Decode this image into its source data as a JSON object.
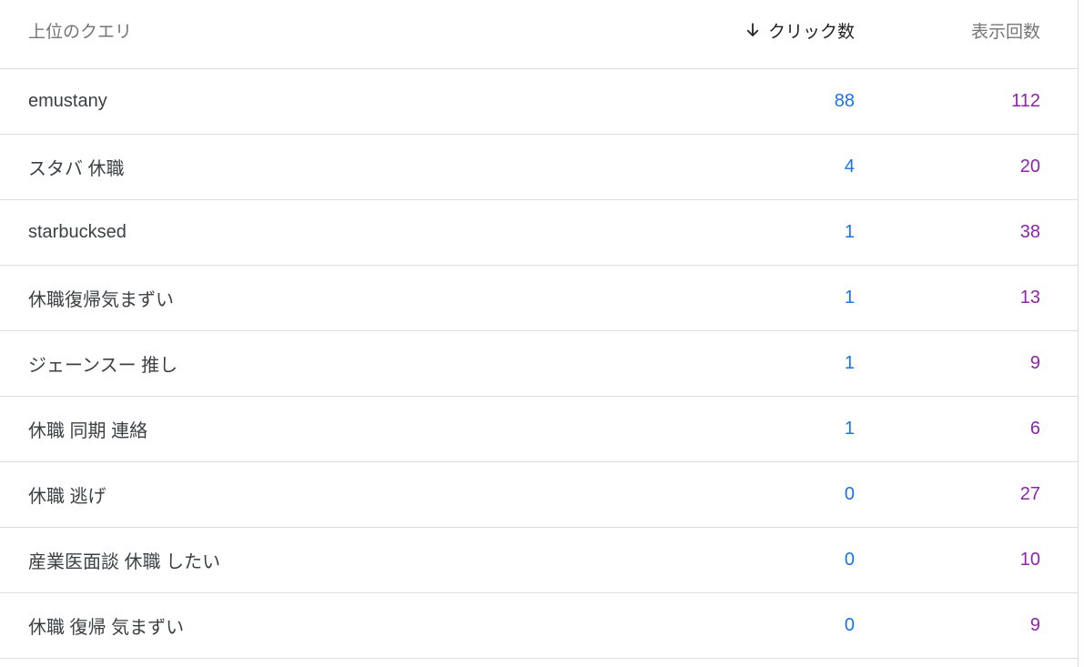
{
  "header": {
    "query_label": "上位のクエリ",
    "clicks_label": "クリック数",
    "impressions_label": "表示回数"
  },
  "rows": [
    {
      "query": "emustany",
      "clicks": "88",
      "impressions": "112"
    },
    {
      "query": "スタバ 休職",
      "clicks": "4",
      "impressions": "20"
    },
    {
      "query": "starbucksed",
      "clicks": "1",
      "impressions": "38"
    },
    {
      "query": "休職復帰気まずい",
      "clicks": "1",
      "impressions": "13"
    },
    {
      "query": "ジェーンスー 推し",
      "clicks": "1",
      "impressions": "9"
    },
    {
      "query": "休職 同期 連絡",
      "clicks": "1",
      "impressions": "6"
    },
    {
      "query": "休職 逃げ",
      "clicks": "0",
      "impressions": "27"
    },
    {
      "query": "産業医面談 休職 したい",
      "clicks": "0",
      "impressions": "10"
    },
    {
      "query": "休職 復帰 気まずい",
      "clicks": "0",
      "impressions": "9"
    }
  ],
  "colors": {
    "clicks": "#1a73e8",
    "impressions": "#8e24aa",
    "divider": "#dadce0"
  },
  "icons": {
    "sort": "arrow-down-icon"
  }
}
